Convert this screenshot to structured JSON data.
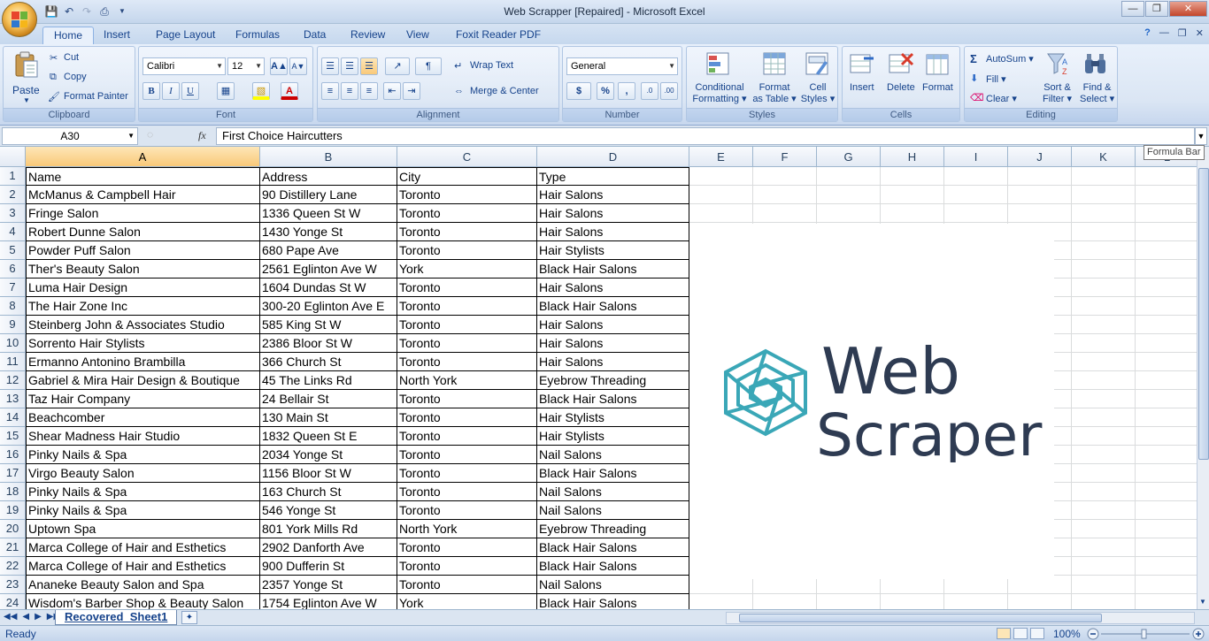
{
  "window": {
    "title": "Web Scrapper [Repaired]  -  Microsoft Excel"
  },
  "tabs": [
    "Home",
    "Insert",
    "Page Layout",
    "Formulas",
    "Data",
    "Review",
    "View",
    "Foxit Reader PDF"
  ],
  "ribbon": {
    "clipboard": {
      "paste": "Paste",
      "cut": "Cut",
      "copy": "Copy",
      "format_painter": "Format Painter",
      "label": "Clipboard"
    },
    "font": {
      "name": "Calibri",
      "size": "12",
      "label": "Font",
      "bold": "B",
      "italic": "I",
      "underline": "U"
    },
    "alignment": {
      "wrap_text": "Wrap Text",
      "merge_center": "Merge & Center",
      "label": "Alignment"
    },
    "number": {
      "format": "General",
      "currency": "$",
      "percent": "%",
      "comma": ",",
      "label": "Number"
    },
    "styles": {
      "conditional": "Conditional",
      "conditional2": "Formatting",
      "format_table": "Format",
      "format_table2": "as Table",
      "cell_styles": "Cell",
      "cell_styles2": "Styles",
      "label": "Styles"
    },
    "cells": {
      "insert": "Insert",
      "delete": "Delete",
      "format": "Format",
      "label": "Cells"
    },
    "editing": {
      "autosum": "AutoSum",
      "fill": "Fill",
      "clear": "Clear",
      "sort": "Sort &",
      "sort2": "Filter",
      "find": "Find &",
      "find2": "Select",
      "label": "Editing"
    }
  },
  "formula_bar": {
    "name_box": "A30",
    "fx": "fx",
    "content": "First Choice Haircutters",
    "tooltip": "Formula Bar"
  },
  "columns": [
    "A",
    "B",
    "C",
    "D",
    "E",
    "F",
    "G",
    "H",
    "I",
    "J",
    "K",
    "L"
  ],
  "rows": [
    [
      "Name",
      "Address",
      "City",
      "Type"
    ],
    [
      "McManus & Campbell Hair",
      "90 Distillery Lane",
      "Toronto",
      "Hair Salons"
    ],
    [
      "Fringe Salon",
      "1336 Queen St W",
      "Toronto",
      "Hair Salons"
    ],
    [
      "Robert Dunne Salon",
      "1430 Yonge St",
      "Toronto",
      "Hair Salons"
    ],
    [
      "Powder Puff Salon",
      "680 Pape Ave",
      "Toronto",
      "Hair Stylists"
    ],
    [
      "Ther's Beauty Salon",
      "2561 Eglinton Ave W",
      "York",
      "Black Hair Salons"
    ],
    [
      "Luma Hair Design",
      "1604 Dundas St W",
      "Toronto",
      "Hair Salons"
    ],
    [
      "The Hair Zone Inc",
      "300-20 Eglinton Ave E",
      "Toronto",
      "Black Hair Salons"
    ],
    [
      "Steinberg John & Associates Studio",
      "585 King St W",
      "Toronto",
      "Hair Salons"
    ],
    [
      "Sorrento Hair Stylists",
      "2386 Bloor St W",
      "Toronto",
      "Hair Salons"
    ],
    [
      "Ermanno Antonino Brambilla",
      "366 Church St",
      "Toronto",
      "Hair Salons"
    ],
    [
      "Gabriel & Mira Hair Design & Boutique",
      "45 The Links Rd",
      "North York",
      "Eyebrow Threading"
    ],
    [
      "Taz Hair Company",
      "24 Bellair St",
      "Toronto",
      "Black Hair Salons"
    ],
    [
      "Beachcomber",
      "130 Main St",
      "Toronto",
      "Hair Stylists"
    ],
    [
      "Shear Madness Hair Studio",
      "1832 Queen St E",
      "Toronto",
      "Hair Stylists"
    ],
    [
      "Pinky Nails & Spa",
      "2034 Yonge St",
      "Toronto",
      "Nail Salons"
    ],
    [
      "Virgo Beauty Salon",
      "1156 Bloor St W",
      "Toronto",
      "Black Hair Salons"
    ],
    [
      "Pinky Nails & Spa",
      "163 Church St",
      "Toronto",
      "Nail Salons"
    ],
    [
      "Pinky Nails & Spa",
      "546 Yonge St",
      "Toronto",
      "Nail Salons"
    ],
    [
      "Uptown Spa",
      "801 York Mills Rd",
      "North York",
      "Eyebrow Threading"
    ],
    [
      "Marca College of Hair and Esthetics",
      "2902 Danforth Ave",
      "Toronto",
      "Black Hair Salons"
    ],
    [
      "Marca College of Hair and Esthetics",
      "900 Dufferin St",
      "Toronto",
      "Black Hair Salons"
    ],
    [
      "Ananeke Beauty Salon and Spa",
      "2357 Yonge St",
      "Toronto",
      "Nail Salons"
    ],
    [
      "Wisdom's Barber Shop & Beauty Salon",
      "1754 Eglinton Ave W",
      "York",
      "Black Hair Salons"
    ]
  ],
  "logo": {
    "line1": "Web",
    "line2": "Scraper"
  },
  "sheet_tab": "Recovered_Sheet1",
  "status": {
    "ready": "Ready",
    "zoom": "100%"
  }
}
